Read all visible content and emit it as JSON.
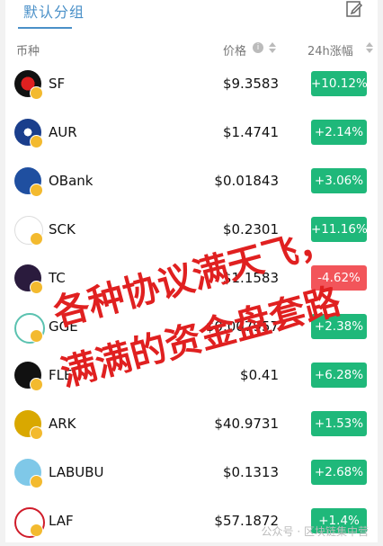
{
  "tabs": {
    "active_label": "默认分组"
  },
  "header": {
    "coin": "币种",
    "price": "价格",
    "change": "24h涨幅"
  },
  "rows": [
    {
      "symbol": "SF",
      "price": "$9.3583",
      "change": "+10.12%",
      "dir": "up"
    },
    {
      "symbol": "AUR",
      "price": "$1.4741",
      "change": "+2.14%",
      "dir": "up"
    },
    {
      "symbol": "OBank",
      "price": "$0.01843",
      "change": "+3.06%",
      "dir": "up"
    },
    {
      "symbol": "SCK",
      "price": "$0.2301",
      "change": "+11.16%",
      "dir": "up"
    },
    {
      "symbol": "TC",
      "price": "$1.1583",
      "change": "-4.62%",
      "dir": "down"
    },
    {
      "symbol": "GGE",
      "price": "$0.007957",
      "change": "+2.38%",
      "dir": "up"
    },
    {
      "symbol": "FLE",
      "price": "$0.41",
      "change": "+6.28%",
      "dir": "up"
    },
    {
      "symbol": "ARK",
      "price": "$40.9731",
      "change": "+1.53%",
      "dir": "up"
    },
    {
      "symbol": "LABUBU",
      "price": "$0.1313",
      "change": "+2.68%",
      "dir": "up"
    },
    {
      "symbol": "LAF",
      "price": "$57.1872",
      "change": "+1.4%",
      "dir": "up"
    }
  ],
  "overlay": {
    "line1": "各种协议满天飞，",
    "line2": "满满的资金盘套路"
  },
  "footer": {
    "watermark": "公众号 · 区块链集中营"
  },
  "colors": {
    "up": "#1fb87a",
    "down": "#f2555a",
    "accent": "#4a90c8"
  }
}
